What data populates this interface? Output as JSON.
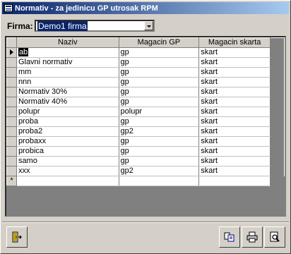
{
  "window": {
    "title": "Normativ - za jedinicu GP utrosak RPM"
  },
  "firma": {
    "label": "Firma:",
    "value": "Demo1 firma"
  },
  "grid": {
    "columns": [
      "Naziv",
      "Magacin GP",
      "Magacin skarta"
    ],
    "rows": [
      {
        "naziv": "ab",
        "gp": "gp",
        "skarta": "skart"
      },
      {
        "naziv": "Glavni normativ",
        "gp": "gp",
        "skarta": "skart"
      },
      {
        "naziv": "mm",
        "gp": "gp",
        "skarta": "skart"
      },
      {
        "naziv": "nnn",
        "gp": "gp",
        "skarta": "skart"
      },
      {
        "naziv": "Normativ 30%",
        "gp": "gp",
        "skarta": "skart"
      },
      {
        "naziv": "Normativ 40%",
        "gp": "gp",
        "skarta": "skart"
      },
      {
        "naziv": "polupr",
        "gp": "polupr",
        "skarta": "skart"
      },
      {
        "naziv": "proba",
        "gp": "gp",
        "skarta": "skart"
      },
      {
        "naziv": "proba2",
        "gp": "gp2",
        "skarta": "skart"
      },
      {
        "naziv": "probaxx",
        "gp": "gp",
        "skarta": "skart"
      },
      {
        "naziv": "probica",
        "gp": "gp",
        "skarta": "skart"
      },
      {
        "naziv": "samo",
        "gp": "gp",
        "skarta": "skart"
      },
      {
        "naziv": "xxx",
        "gp": "gp2",
        "skarta": "skart"
      }
    ],
    "new_row_marker": "*"
  },
  "toolbar": {
    "exit_icon": "exit-door-icon",
    "copy_icon": "copy-icon",
    "print_icon": "printer-icon",
    "preview_icon": "print-preview-icon"
  }
}
